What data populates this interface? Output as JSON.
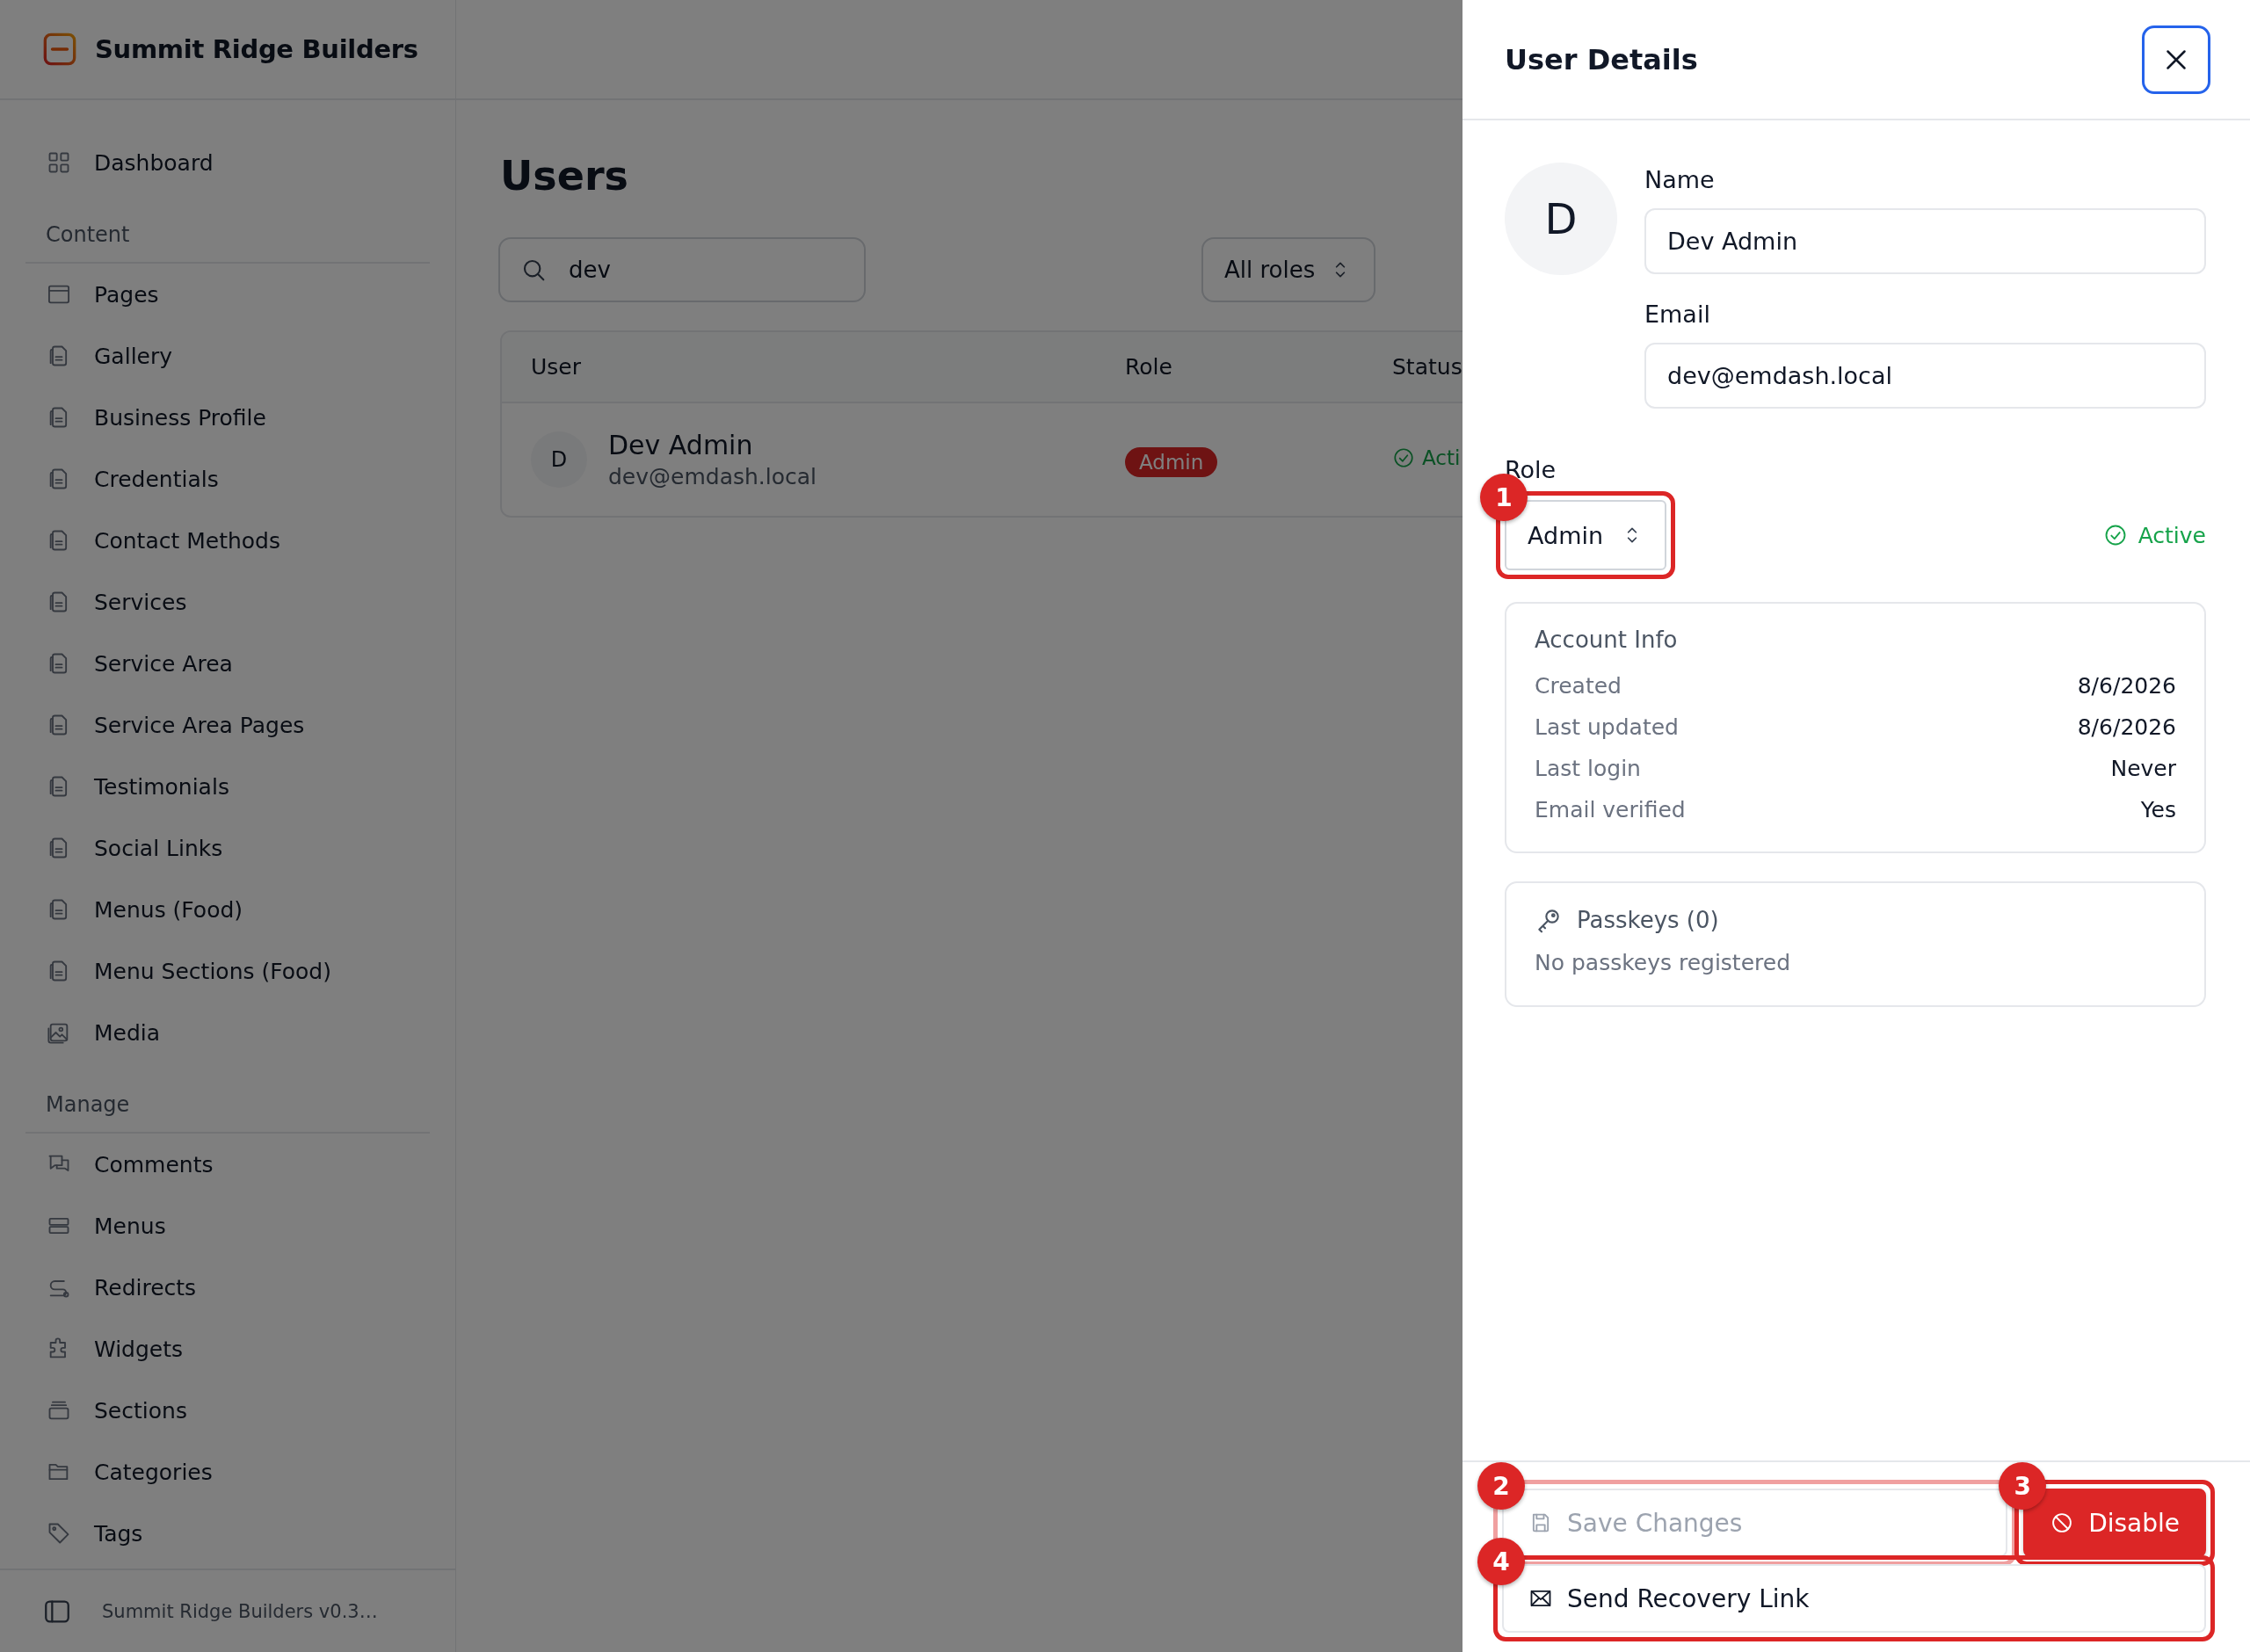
{
  "brand": {
    "name": "Summit Ridge Builders"
  },
  "sidebar": {
    "groups": [
      {
        "items": [
          {
            "label": "Dashboard",
            "kind": "grid",
            "selected": false
          }
        ]
      },
      {
        "heading": "Content",
        "items": [
          {
            "label": "Pages",
            "kind": "window",
            "selected": false
          },
          {
            "label": "Gallery",
            "kind": "document",
            "selected": false
          },
          {
            "label": "Business Profile",
            "kind": "document",
            "selected": false
          },
          {
            "label": "Credentials",
            "kind": "document",
            "selected": false
          },
          {
            "label": "Contact Methods",
            "kind": "document",
            "selected": false
          },
          {
            "label": "Services",
            "kind": "document",
            "selected": false
          },
          {
            "label": "Service Area",
            "kind": "document",
            "selected": false
          },
          {
            "label": "Service Area Pages",
            "kind": "document",
            "selected": false
          },
          {
            "label": "Testimonials",
            "kind": "document",
            "selected": false
          },
          {
            "label": "Social Links",
            "kind": "document",
            "selected": false
          },
          {
            "label": "Menus (Food)",
            "kind": "document",
            "selected": false
          },
          {
            "label": "Menu Sections (Food)",
            "kind": "document",
            "selected": false
          },
          {
            "label": "Media",
            "kind": "image",
            "selected": false
          }
        ]
      },
      {
        "heading": "Manage",
        "items": [
          {
            "label": "Comments",
            "kind": "comments",
            "selected": false
          },
          {
            "label": "Menus",
            "kind": "menus",
            "selected": false
          },
          {
            "label": "Redirects",
            "kind": "redirect",
            "selected": false
          },
          {
            "label": "Widgets",
            "kind": "puzzle",
            "selected": false
          },
          {
            "label": "Sections",
            "kind": "sections",
            "selected": false
          },
          {
            "label": "Categories",
            "kind": "folder",
            "selected": false
          },
          {
            "label": "Tags",
            "kind": "tag",
            "selected": false
          }
        ]
      }
    ],
    "footer": "Summit Ridge Builders v0.3…"
  },
  "page": {
    "title": "Users",
    "search": {
      "value": "dev"
    },
    "role_filter": {
      "value": "All roles"
    },
    "table": {
      "columns": [
        "User",
        "Role",
        "Status"
      ],
      "rows": [
        {
          "initial": "D",
          "name": "Dev Admin",
          "email": "dev@emdash.local",
          "role": "Admin",
          "status": "Acti"
        }
      ]
    }
  },
  "panel": {
    "title": "User Details",
    "avatar": "D",
    "fields": [
      {
        "label": "Name",
        "value": "Dev Admin"
      },
      {
        "label": "Email",
        "value": "dev@emdash.local"
      }
    ],
    "role": {
      "label": "Role",
      "value": "Admin",
      "callout": {
        "number": "1",
        "faded": false
      }
    },
    "status": "Active",
    "account_info": {
      "title": "Account Info",
      "rows": [
        {
          "label": "Created",
          "value": "8/6/2026"
        },
        {
          "label": "Last updated",
          "value": "8/6/2026"
        },
        {
          "label": "Last login",
          "value": "Never"
        },
        {
          "label": "Email verified",
          "value": "Yes"
        }
      ]
    },
    "passkeys": {
      "title": "Passkeys (0)",
      "empty": "No passkeys registered"
    },
    "actions": [
      {
        "label": "Save Changes",
        "kind": "save",
        "disabled": true,
        "callout": {
          "number": "2",
          "faded": true
        }
      },
      {
        "label": "Disable",
        "kind": "danger",
        "disabled": false,
        "callout": {
          "number": "3",
          "faded": false
        }
      },
      {
        "label": "Send Recovery Link",
        "kind": "recovery",
        "disabled": false,
        "callout": {
          "number": "4",
          "faded": false
        }
      }
    ]
  }
}
